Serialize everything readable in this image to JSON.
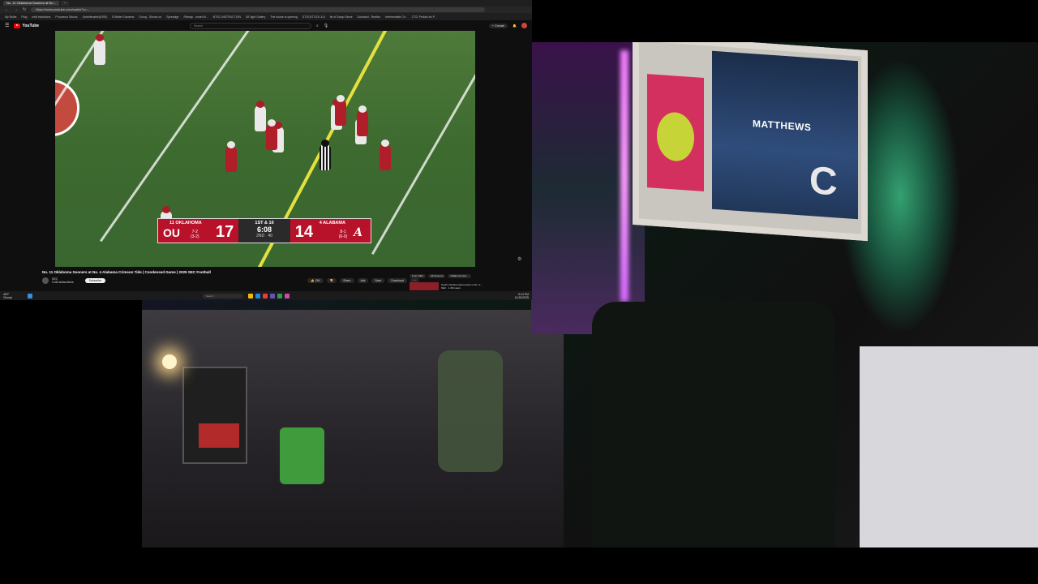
{
  "browser": {
    "tabs": [
      "No. 11 Oklahoma Sooners at No...",
      "",
      ""
    ],
    "url": "https://www.youtube.com/watch?v=...",
    "bookmarks": [
      "My Bulbs",
      "Plug",
      "crfdl tradotions",
      "Processor Stocks",
      "Unbelievable(IDSE)",
      "B Better Gardens",
      "Going - Shows on",
      "Spreadge",
      "Rdreap - smart M...",
      "NTSC INSTRUCTION",
      "DE light Gallery",
      "The house is opening",
      "STOCKTOCK & 6",
      "bit of Scrap Stone",
      "Durkland - Realtor",
      "Intermediate Ch..",
      "CTD: Pedals for P.."
    ]
  },
  "youtube": {
    "logo": "YouTube",
    "search_placeholder": "Search",
    "create_label": "+ Create",
    "video_title": "No. 11 Oklahoma Sooners at No. 4 Alabama Crimson Tide | Condensed Game | 2025 SEC Football",
    "channel_name": "SEC",
    "channel_subs": "3.4M subscribers",
    "subscribe_label": "Subscribe",
    "actions": [
      "👍 15K",
      "👎",
      "Share",
      "Ask",
      "Save",
      "Download",
      "⋯"
    ],
    "chips": [
      "From SEC",
      "All Sooners",
      "Oklahoma Soo..."
    ],
    "rec_title": "South Carolina Gamecocks vs No. 2...",
    "rec_sub": "SEC · 1.2M views"
  },
  "scorebug": {
    "left_rank": "11 OKLAHOMA",
    "left_logo": "OU",
    "left_record": "7-2",
    "left_conf": "(3-2)",
    "left_score": "17",
    "down": "1ST & 10",
    "clock": "6:08",
    "quarter": "2ND",
    "playclock": "40",
    "right_rank": "4 ALABAMA",
    "right_logo": "A",
    "right_record": "8-1",
    "right_conf": "(6-0)",
    "right_score": "14"
  },
  "taskbar": {
    "weather_temp": "46°F",
    "weather_desc": "Cloudy",
    "search_placeholder": "Search",
    "time": "9:14 PM",
    "date": "11/15/2025"
  },
  "webcam": {
    "poster_name": "MATTHEWS",
    "poster_letter": "C"
  },
  "colors": {
    "youtube_red": "#ff0000",
    "crimson": "#b8122a",
    "field": "#3d6a2f"
  }
}
